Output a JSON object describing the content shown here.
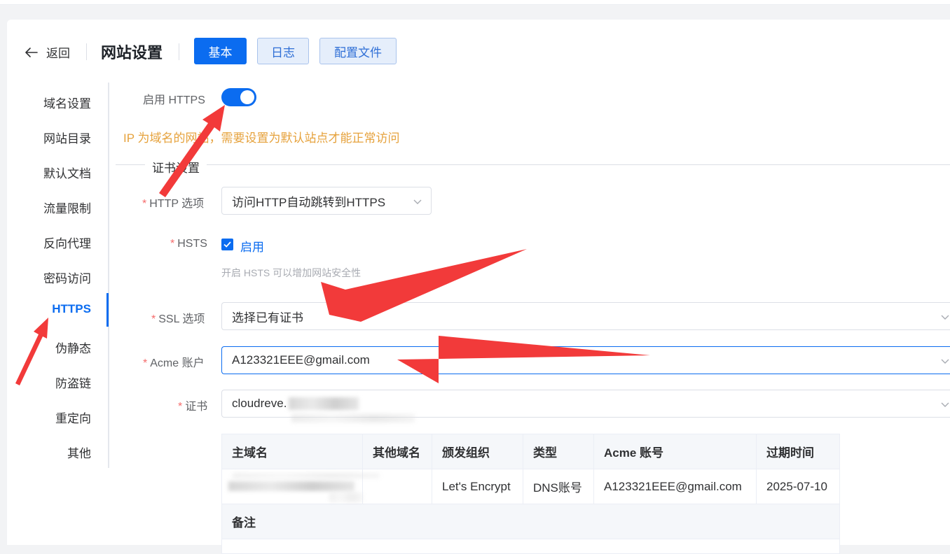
{
  "header": {
    "back_label": "返回",
    "title": "网站设置",
    "tabs": [
      {
        "label": "基本",
        "active": true
      },
      {
        "label": "日志",
        "active": false
      },
      {
        "label": "配置文件",
        "active": false
      }
    ]
  },
  "sidebar": {
    "items": [
      {
        "label": "域名设置"
      },
      {
        "label": "网站目录"
      },
      {
        "label": "默认文档"
      },
      {
        "label": "流量限制"
      },
      {
        "label": "反向代理"
      },
      {
        "label": "密码访问"
      },
      {
        "label": "HTTPS",
        "active": true
      },
      {
        "label": "伪静态"
      },
      {
        "label": "防盗链"
      },
      {
        "label": "重定向"
      },
      {
        "label": "其他"
      }
    ]
  },
  "form": {
    "enable_https_label": "启用 HTTPS",
    "enable_https_value": true,
    "warning": "IP 为域名的网站，需要设置为默认站点才能正常访问",
    "section_title": "证书设置",
    "http_option_label": "HTTP 选项",
    "http_option_value": "访问HTTP自动跳转到HTTPS",
    "hsts_label": "HSTS",
    "hsts_checkbox_label": "启用",
    "hsts_hint": "开启 HSTS 可以增加网站安全性",
    "ssl_label": "SSL 选项",
    "ssl_value": "选择已有证书",
    "acme_label": "Acme 账户",
    "acme_value": "A123321EEE@gmail.com",
    "cert_label": "证书",
    "cert_value": "cloudreve."
  },
  "cert_table": {
    "headers": [
      "主域名",
      "其他域名",
      "颁发组织",
      "类型",
      "Acme 账号",
      "过期时间"
    ],
    "row": {
      "primary_domain": "",
      "other_domains": "",
      "issuer": "Let's Encrypt",
      "type": "DNS账号",
      "acme_account": "A123321EEE@gmail.com",
      "expires": "2025-07-10"
    },
    "remark_header": "备注"
  },
  "colors": {
    "primary": "#0b6cf0",
    "warning": "#e6a23c",
    "required": "#f56c6c",
    "annotation_arrow": "#f23a3a"
  },
  "icons": {
    "back": "arrow-left-icon",
    "dropdown": "chevron-down-icon",
    "check": "check-icon"
  }
}
